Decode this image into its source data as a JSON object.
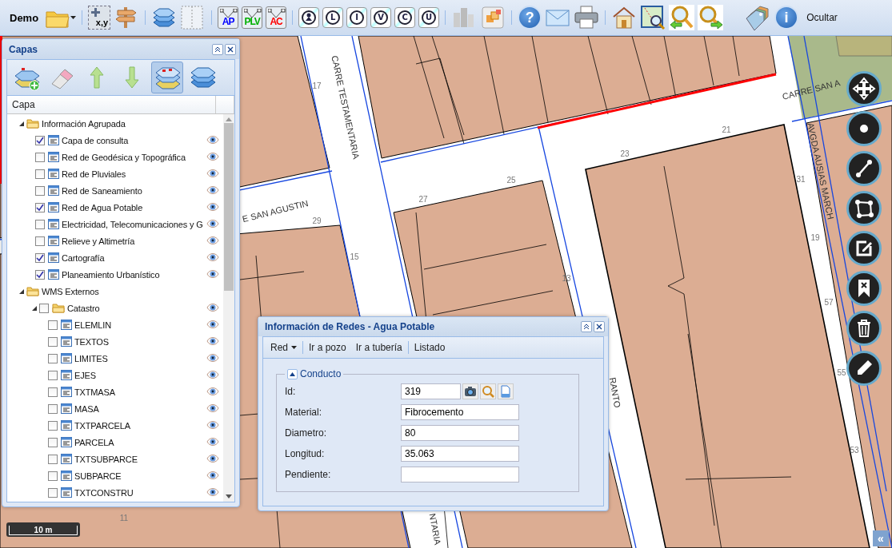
{
  "toolbar": {
    "title": "Demo",
    "items": [
      {
        "kind": "folder"
      },
      {
        "kind": "separator"
      },
      {
        "kind": "coords",
        "label": "x,y"
      },
      {
        "kind": "signpost"
      },
      {
        "kind": "separator"
      },
      {
        "kind": "layers"
      },
      {
        "kind": "frame"
      },
      {
        "kind": "separator"
      },
      {
        "kind": "profile",
        "label": "AP",
        "color": "#0000ff"
      },
      {
        "kind": "profile",
        "label": "PLV",
        "color": "#00b000"
      },
      {
        "kind": "profile",
        "label": "AC",
        "color": "#ff0000"
      },
      {
        "kind": "separator"
      },
      {
        "kind": "marker-person"
      },
      {
        "kind": "marker",
        "label": "L"
      },
      {
        "kind": "marker",
        "label": "I"
      },
      {
        "kind": "marker",
        "label": "V"
      },
      {
        "kind": "marker",
        "label": "C"
      },
      {
        "kind": "marker",
        "label": "U"
      },
      {
        "kind": "separator"
      },
      {
        "kind": "city"
      },
      {
        "kind": "squares"
      },
      {
        "kind": "separator"
      },
      {
        "kind": "round",
        "label": "?"
      },
      {
        "kind": "mail"
      },
      {
        "kind": "print"
      },
      {
        "kind": "separator"
      },
      {
        "kind": "home"
      },
      {
        "kind": "map-zoom"
      },
      {
        "kind": "zoom-back"
      },
      {
        "kind": "zoom-forward"
      },
      {
        "kind": "spacer"
      },
      {
        "kind": "tags"
      },
      {
        "kind": "round",
        "label": "i"
      }
    ],
    "hide_label": "Ocultar"
  },
  "layers_panel": {
    "title": "Capas",
    "tools": [
      {
        "kind": "add-layer",
        "selected": false
      },
      {
        "kind": "eraser",
        "selected": false
      },
      {
        "kind": "up",
        "selected": false
      },
      {
        "kind": "down",
        "selected": false
      },
      {
        "kind": "color-layers",
        "selected": true
      },
      {
        "kind": "plain-layers",
        "selected": false
      }
    ],
    "column": "Capa",
    "tree": [
      {
        "kind": "group",
        "label": "Información Agrupada",
        "expanded": true,
        "children": [
          {
            "kind": "layer",
            "label": "Capa de consulta",
            "checked": true
          },
          {
            "kind": "layer",
            "label": "Red de Geodésica y Topográfica",
            "checked": false
          },
          {
            "kind": "layer",
            "label": "Red de Pluviales",
            "checked": false
          },
          {
            "kind": "layer",
            "label": "Red de Saneamiento",
            "checked": false
          },
          {
            "kind": "layer",
            "label": "Red de Agua Potable",
            "checked": true
          },
          {
            "kind": "layer",
            "label": "Electricidad, Telecomunicaciones y G",
            "checked": false
          },
          {
            "kind": "layer",
            "label": "Relieve y Altimetría",
            "checked": false
          },
          {
            "kind": "layer",
            "label": "Cartografía",
            "checked": true
          },
          {
            "kind": "layer",
            "label": "Planeamiento Urbanístico",
            "checked": true
          }
        ]
      },
      {
        "kind": "group",
        "label": "WMS Externos",
        "expanded": true,
        "children": [
          {
            "kind": "group",
            "label": "Catastro",
            "expanded": true,
            "checked": false,
            "children": [
              {
                "kind": "layer",
                "label": "ELEMLIN",
                "checked": false
              },
              {
                "kind": "layer",
                "label": "TEXTOS",
                "checked": false
              },
              {
                "kind": "layer",
                "label": "LIMITES",
                "checked": false
              },
              {
                "kind": "layer",
                "label": "EJES",
                "checked": false
              },
              {
                "kind": "layer",
                "label": "TXTMASA",
                "checked": false
              },
              {
                "kind": "layer",
                "label": "MASA",
                "checked": false
              },
              {
                "kind": "layer",
                "label": "TXTPARCELA",
                "checked": false
              },
              {
                "kind": "layer",
                "label": "PARCELA",
                "checked": false
              },
              {
                "kind": "layer",
                "label": "TXTSUBPARCE",
                "checked": false
              },
              {
                "kind": "layer",
                "label": "SUBPARCE",
                "checked": false
              },
              {
                "kind": "layer",
                "label": "TXTCONSTRU",
                "checked": false
              }
            ]
          }
        ]
      }
    ]
  },
  "info_dialog": {
    "title": "Información de Redes - Agua Potable",
    "menu": [
      {
        "kind": "dropdown",
        "label": "Red"
      },
      {
        "kind": "separator"
      },
      {
        "kind": "button",
        "label": "Ir a pozo"
      },
      {
        "kind": "button",
        "label": "Ir a tubería"
      },
      {
        "kind": "separator"
      },
      {
        "kind": "button",
        "label": "Listado"
      }
    ],
    "section": {
      "title": "Conducto",
      "expanded": true,
      "fields": [
        {
          "label": "Id:",
          "value": "319",
          "actions": [
            {
              "kind": "camera"
            },
            {
              "kind": "search"
            },
            {
              "kind": "document"
            }
          ]
        },
        {
          "label": "Material:",
          "value": "Fibrocemento"
        },
        {
          "label": "Diametro:",
          "value": "80"
        },
        {
          "label": "Longitud:",
          "value": "35.063"
        },
        {
          "label": "Pendiente:"
        }
      ]
    }
  },
  "map": {
    "labels": [
      {
        "kind": "street",
        "text": "CARRE TESTAMENTARIA"
      },
      {
        "kind": "street",
        "text": "E SAN AGUSTIN"
      },
      {
        "kind": "street",
        "text": "CARRE SAN A"
      },
      {
        "kind": "street",
        "text": "AVGDA AUSIAS MARCH"
      },
      {
        "kind": "street",
        "text": "RANTO"
      },
      {
        "kind": "street",
        "text": "NTARIA"
      },
      {
        "kind": "number",
        "text": "17"
      },
      {
        "kind": "number",
        "text": "21"
      },
      {
        "kind": "number",
        "text": "23"
      },
      {
        "kind": "number",
        "text": "25"
      },
      {
        "kind": "number",
        "text": "27"
      },
      {
        "kind": "number",
        "text": "29"
      },
      {
        "kind": "number",
        "text": "15"
      },
      {
        "kind": "number",
        "text": "13"
      },
      {
        "kind": "number",
        "text": "31"
      },
      {
        "kind": "number",
        "text": "19"
      },
      {
        "kind": "number",
        "text": "57"
      },
      {
        "kind": "number",
        "text": "55"
      },
      {
        "kind": "number",
        "text": "53"
      },
      {
        "kind": "number",
        "text": "11"
      }
    ]
  },
  "draw_tools": [
    {
      "kind": "pan"
    },
    {
      "kind": "point"
    },
    {
      "kind": "line"
    },
    {
      "kind": "polygon"
    },
    {
      "kind": "edit"
    },
    {
      "kind": "delete-feature"
    },
    {
      "kind": "trash"
    },
    {
      "kind": "pencil"
    }
  ],
  "scale": "10 m",
  "collapse_button": "«"
}
